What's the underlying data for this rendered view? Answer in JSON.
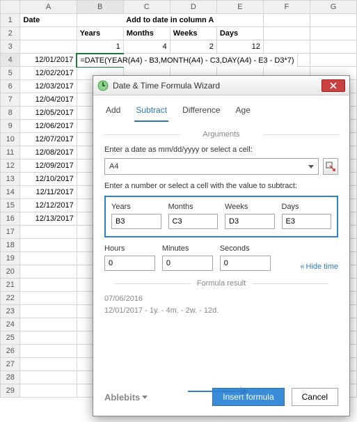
{
  "columns": [
    "A",
    "B",
    "C",
    "D",
    "E",
    "F",
    "G"
  ],
  "rows": [
    "1",
    "2",
    "3",
    "4",
    "5",
    "6",
    "7",
    "8",
    "9",
    "10",
    "11",
    "12",
    "13",
    "14",
    "15",
    "16",
    "17",
    "18",
    "19",
    "20",
    "21",
    "22",
    "23",
    "24",
    "25",
    "26",
    "27",
    "28",
    "29"
  ],
  "row1": {
    "A": "Date",
    "B_merged": "Add to date in column A"
  },
  "row2": {
    "B": "Years",
    "C": "Months",
    "D": "Weeks",
    "E": "Days"
  },
  "row3": {
    "B": "1",
    "C": "4",
    "D": "2",
    "E": "12"
  },
  "dates": [
    "12/01/2017",
    "12/02/2017",
    "12/03/2017",
    "12/04/2017",
    "12/05/2017",
    "12/06/2017",
    "12/07/2017",
    "12/08/2017",
    "12/09/2017",
    "12/10/2017",
    "12/11/2017",
    "12/12/2017",
    "12/13/2017"
  ],
  "formula_text": "=DATE(YEAR(A4) - B3,MONTH(A4) - C3,DAY(A4) - E3 - D3*7)",
  "dialog": {
    "title": "Date & Time Formula Wizard",
    "tabs": {
      "add": "Add",
      "subtract": "Subtract",
      "difference": "Difference",
      "age": "Age"
    },
    "args_label": "Arguments",
    "date_label": "Enter a date as mm/dd/yyyy or select a cell:",
    "date_value": "A4",
    "value_label": "Enter a number or select a cell with the value to subtract:",
    "fields": {
      "years_l": "Years",
      "years_v": "B3",
      "months_l": "Months",
      "months_v": "C3",
      "weeks_l": "Weeks",
      "weeks_v": "D3",
      "days_l": "Days",
      "days_v": "E3",
      "hours_l": "Hours",
      "hours_v": "0",
      "minutes_l": "Minutes",
      "minutes_v": "0",
      "seconds_l": "Seconds",
      "seconds_v": "0"
    },
    "hide_time": "Hide time",
    "result_label": "Formula result",
    "result_date": "07/06/2016",
    "result_detail": "12/01/2017 - 1y. - 4m. - 2w. - 12d.",
    "brand": "Ablebits",
    "insert_btn": "Insert formula",
    "cancel_btn": "Cancel"
  }
}
